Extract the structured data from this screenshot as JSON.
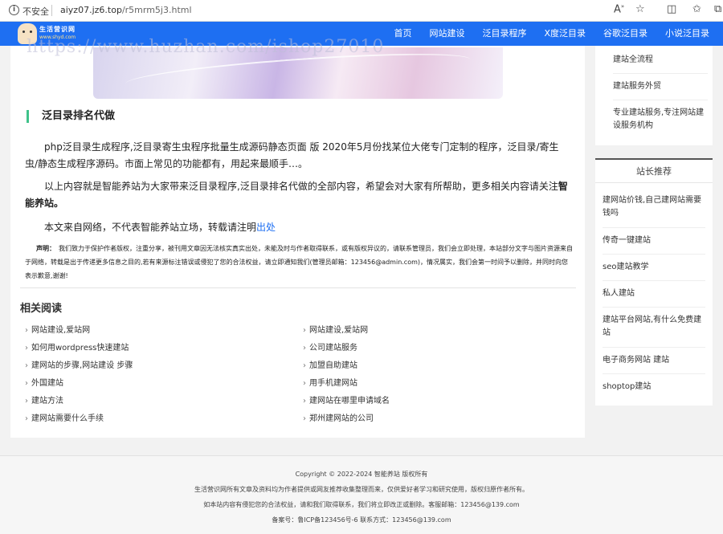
{
  "browser": {
    "security_label": "不安全",
    "url_host": "aiyz07.jz6.top",
    "url_path": "/r5mrm5j3.html"
  },
  "header": {
    "logo_text": "生活营识网",
    "logo_sub": "www.shyd.com",
    "nav": [
      "首页",
      "网站建设",
      "泛目录程序",
      "X度泛目录",
      "谷歌泛目录",
      "小说泛目录"
    ]
  },
  "watermark": "https://www.huzhan.com/ishop27010",
  "article": {
    "section_title": "泛目录排名代做",
    "para1": "php泛目录生成程序,泛目录寄生虫程序批量生成源码静态页面 版 2020年5月份找某位大佬专门定制的程序，泛目录/寄生虫/静态生成程序源码。市面上常见的功能都有，用起来最顺手…。",
    "para2_text": "以上内容就是智能养站为大家带来泛目录程序,泛目录排名代做的全部内容，希望会对大家有所帮助，更多相关内容请关注",
    "para2_bold": "智能养站。",
    "para3_text": "本文来自网络，不代表智能养站立场，转载请注明",
    "para3_link": "出处",
    "disclaimer_label": "声明：",
    "disclaimer_text": "我们致力于保护作者版权，注重分享，被刊用文章因无法核实真实出处，未能及时与作者取得联系，或有版权异议的，请联系管理员，我们会立即处理，本站部分文字与图片资源来自于网络，转载是出于传递更多信息之目的,若有来源标注错误或侵犯了您的合法权益，请立即通知我们(管理员邮箱：123456@admin.com)，情况属实，我们会第一时间予以删除，并同时向您表示歉意,谢谢!"
  },
  "related": {
    "title": "相关阅读",
    "left": [
      "网站建设,爱站网",
      "如何用wordpress快速建站",
      "建网站的步骤,网站建设 步骤",
      "外国建站",
      "建站方法",
      "建网站需要什么手续"
    ],
    "right": [
      "网站建设,爱站网",
      "公司建站服务",
      "加盟自助建站",
      "用手机建网站",
      "建网站在哪里申请域名",
      "郑州建网站的公司"
    ]
  },
  "sidebar_top": [
    "建站全流程",
    "建站服务外贸",
    "专业建站服务,专注网站建设服务机构"
  ],
  "sidebar_rec": {
    "title": "站长推荐",
    "items": [
      "建网站价钱,自己建网站需要钱吗",
      "传奇一键建站",
      "seo建站教学",
      "私人建站",
      "建站平台网站,有什么免费建站",
      "电子商务网站 建站",
      "shoptop建站"
    ]
  },
  "footer": {
    "line1": "Copyright © 2022-2024 智能养站 版权所有",
    "line2": "生活营识网所有文章及资料均为作者提供或网友推荐收集整理而来，仅供爱好者学习和研究使用，版权归原作者所有。",
    "line3": "如本站内容有侵犯您的合法权益，请和我们取得联系，我们将立即改正或删除。客服邮箱：123456@139.com",
    "line4": "备案号：鲁ICP备123456号-6 联系方式：123456@139.com"
  }
}
